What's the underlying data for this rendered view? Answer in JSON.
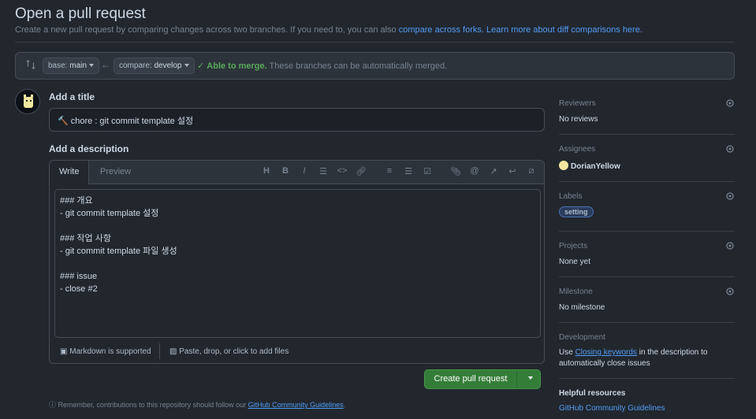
{
  "page": {
    "title": "Open a pull request",
    "subtitle_text": "Create a new pull request by comparing changes across two branches. If you need to, you can also ",
    "compare_forks_link": "compare across forks.",
    "learn_more_link": "Learn more about diff comparisons here."
  },
  "branch_bar": {
    "base_prefix": "base: ",
    "base_branch": "main",
    "compare_prefix": "compare: ",
    "compare_branch": "develop",
    "merge_status": "Able to merge.",
    "merge_message": "These branches can be automatically merged."
  },
  "form": {
    "title_label": "Add a title",
    "title_value": "🔨 chore : git commit template 설정",
    "description_label": "Add a description",
    "tabs": [
      "Write",
      "Preview"
    ],
    "description_value": "### 개요\n- git commit template 설정\n\n### 작업 사항\n- git commit template 파일 생성\n\n### issue\n- close #2",
    "markdown_note": "Markdown is supported",
    "attach_note": "Paste, drop, or click to add files",
    "submit_label": "Create pull request",
    "remember_text": "Remember, contributions to this repository should follow our ",
    "guidelines_link": "GitHub Community Guidelines",
    "remember_end": "."
  },
  "sidebar": {
    "reviewers": {
      "heading": "Reviewers",
      "value": "No reviews"
    },
    "assignees": {
      "heading": "Assignees",
      "value": "DorianYellow"
    },
    "labels": {
      "heading": "Labels",
      "value": "setting"
    },
    "projects": {
      "heading": "Projects",
      "value": "None yet"
    },
    "milestone": {
      "heading": "Milestone",
      "value": "No milestone"
    },
    "development": {
      "heading": "Development",
      "text_before": "Use ",
      "link": "Closing keywords",
      "text_after": " in the description to automatically close issues"
    },
    "helpful": {
      "heading": "Helpful resources",
      "link": "GitHub Community Guidelines"
    }
  },
  "colors": {
    "background": "#22272e",
    "accent_link": "#539bf5",
    "success": "#57ab5a",
    "button_green": "#347d39"
  }
}
